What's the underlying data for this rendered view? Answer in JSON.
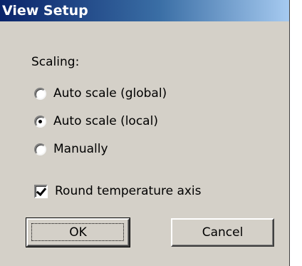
{
  "window": {
    "title": "View Setup"
  },
  "scaling": {
    "label": "Scaling:",
    "options": [
      {
        "label": "Auto scale (global)",
        "checked": false
      },
      {
        "label": "Auto scale (local)",
        "checked": true
      },
      {
        "label": "Manually",
        "checked": false
      }
    ]
  },
  "round_axis": {
    "label": "Round temperature axis",
    "checked": true
  },
  "buttons": {
    "ok_label": "OK",
    "cancel_label": "Cancel"
  },
  "colors": {
    "dialog_background": "#d4d0c8",
    "titlebar_start": "#0a246a",
    "titlebar_end": "#a6caf0",
    "titlebar_text": "#ffffff"
  }
}
